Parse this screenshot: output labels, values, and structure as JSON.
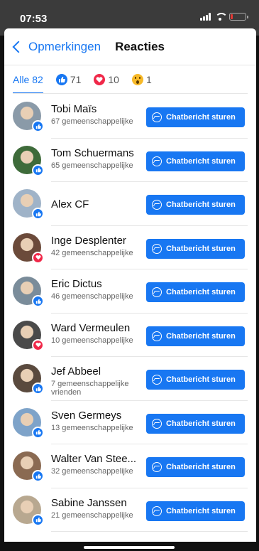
{
  "status": {
    "time": "07:53"
  },
  "nav": {
    "back_label": "Opmerkingen",
    "title": "Reacties"
  },
  "tabs": [
    {
      "label": "Alle 82",
      "icon": "none"
    },
    {
      "label": "71",
      "icon": "like-icon"
    },
    {
      "label": "10",
      "icon": "love-icon"
    },
    {
      "label": "1",
      "icon": "wow-icon"
    }
  ],
  "button_label": "Chatbericht sturen",
  "people": [
    {
      "name": "Tobi Maïs",
      "sub": "67 gemeenschappelijke",
      "reaction": "like"
    },
    {
      "name": "Tom Schuermans",
      "sub": "65 gemeenschappelijke",
      "reaction": "like"
    },
    {
      "name": "Alex CF",
      "sub": "",
      "reaction": "like"
    },
    {
      "name": "Inge Desplenter",
      "sub": "42 gemeenschappelijke",
      "reaction": "love"
    },
    {
      "name": "Eric Dictus",
      "sub": "46 gemeenschappelijke",
      "reaction": "like"
    },
    {
      "name": "Ward Vermeulen",
      "sub": "10 gemeenschappelijke",
      "reaction": "love"
    },
    {
      "name": "Jef Abbeel",
      "sub": "7 gemeenschappelijke vrienden",
      "reaction": "like"
    },
    {
      "name": "Sven Germeys",
      "sub": "13 gemeenschappelijke",
      "reaction": "like"
    },
    {
      "name": "Walter Van Stee...",
      "sub": "32 gemeenschappelijke",
      "reaction": "like"
    },
    {
      "name": "Sabine Janssen",
      "sub": "21 gemeenschappelijke",
      "reaction": "like"
    }
  ],
  "colors": {
    "accent": "#1877f2",
    "love": "#f02849",
    "wow": "#f7b928"
  }
}
